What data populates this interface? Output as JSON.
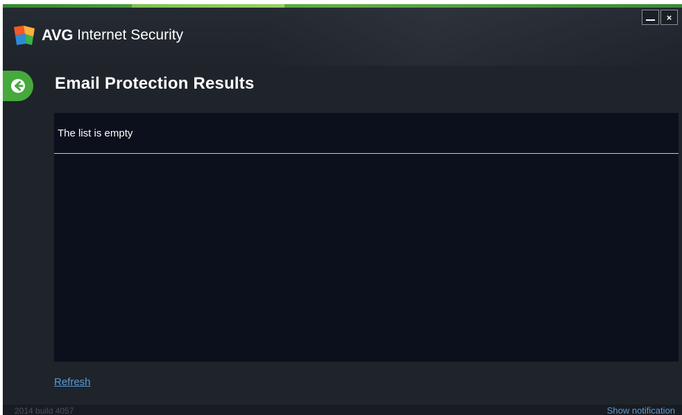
{
  "app": {
    "brand": "AVG",
    "product": "Internet Security"
  },
  "window_controls": {
    "minimize": "minimize-icon",
    "close_label": "×"
  },
  "page": {
    "title": "Email Protection Results",
    "back_icon": "back-arrow-icon"
  },
  "results": {
    "empty_message": "The list is empty"
  },
  "actions": {
    "refresh_label": "Refresh"
  },
  "status_bar": {
    "build_text": "2014  build 4057",
    "notification_link": "Show notification"
  },
  "colors": {
    "accent_green": "#45a93c",
    "link_blue": "#5b9ad6",
    "window_bg": "#1f242b",
    "panel_bg": "#0c101c"
  }
}
